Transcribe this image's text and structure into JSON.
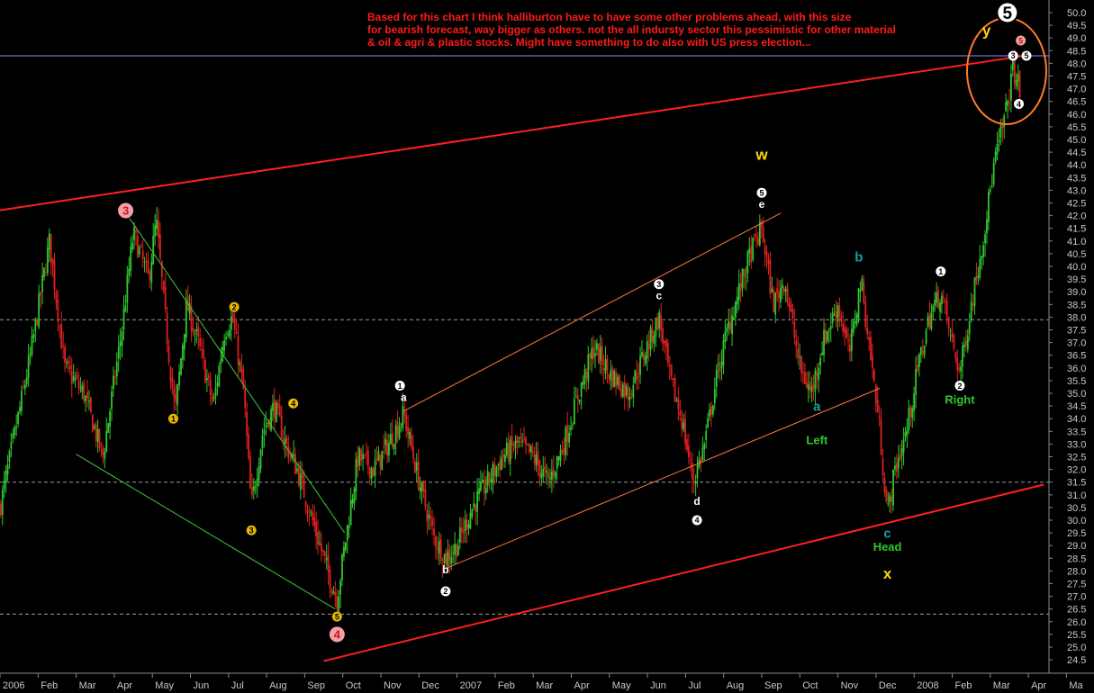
{
  "chart_data": {
    "type": "candlestick",
    "annotation_lines": [
      "Based for this chart I think halliburton have to have some other problems ahead, with this size",
      "for bearish forecast, way bigger as others. not the all indursty sector this pessimistic for other material",
      "& oil & agri & plastic stocks. Might have something to do also with US press election..."
    ],
    "x_ticks": [
      "2006",
      "Feb",
      "Mar",
      "Apr",
      "May",
      "Jun",
      "Jul",
      "Aug",
      "Sep",
      "Oct",
      "Nov",
      "Dec",
      "2007",
      "Feb",
      "Mar",
      "Apr",
      "May",
      "Jun",
      "Jul",
      "Aug",
      "Sep",
      "Oct",
      "Nov",
      "Dec",
      "2008",
      "Feb",
      "Mar",
      "Apr",
      "Ma"
    ],
    "ylim": [
      24.5,
      50.0
    ],
    "y_ticks": [
      24.5,
      25.0,
      25.5,
      26.0,
      26.5,
      27.0,
      27.5,
      28.0,
      28.5,
      29.0,
      29.5,
      30.0,
      30.5,
      31.0,
      31.5,
      32.0,
      32.5,
      33.0,
      33.5,
      34.0,
      34.5,
      35.0,
      35.5,
      36.0,
      36.5,
      37.0,
      37.5,
      38.0,
      38.5,
      39.0,
      39.5,
      40.0,
      40.5,
      41.0,
      41.5,
      42.0,
      42.5,
      43.0,
      43.5,
      44.0,
      44.5,
      45.0,
      45.5,
      46.0,
      46.5,
      47.0,
      47.5,
      48.0,
      48.5,
      49.0,
      49.5,
      50.0
    ],
    "price_pivots": [
      {
        "t": 0.0,
        "p": 30.5
      },
      {
        "t": 0.8,
        "p": 36.5
      },
      {
        "t": 1.3,
        "p": 41.0
      },
      {
        "t": 1.7,
        "p": 36.0
      },
      {
        "t": 2.2,
        "p": 35.0
      },
      {
        "t": 2.7,
        "p": 32.5
      },
      {
        "t": 3.2,
        "p": 37.5
      },
      {
        "t": 3.5,
        "p": 41.3
      },
      {
        "t": 3.9,
        "p": 39.5
      },
      {
        "t": 4.1,
        "p": 41.8
      },
      {
        "t": 4.4,
        "p": 37.0
      },
      {
        "t": 4.6,
        "p": 34.2
      },
      {
        "t": 4.9,
        "p": 38.5
      },
      {
        "t": 5.2,
        "p": 37.0
      },
      {
        "t": 5.6,
        "p": 34.5
      },
      {
        "t": 5.9,
        "p": 37.5
      },
      {
        "t": 6.1,
        "p": 38.0
      },
      {
        "t": 6.4,
        "p": 35.0
      },
      {
        "t": 6.6,
        "p": 30.5
      },
      {
        "t": 6.9,
        "p": 33.5
      },
      {
        "t": 7.2,
        "p": 34.5
      },
      {
        "t": 7.5,
        "p": 33.0
      },
      {
        "t": 7.8,
        "p": 32.0
      },
      {
        "t": 8.2,
        "p": 30.0
      },
      {
        "t": 8.6,
        "p": 28.0
      },
      {
        "t": 8.85,
        "p": 26.9
      },
      {
        "t": 9.1,
        "p": 29.5
      },
      {
        "t": 9.4,
        "p": 32.5
      },
      {
        "t": 9.8,
        "p": 32.0
      },
      {
        "t": 10.2,
        "p": 33.0
      },
      {
        "t": 10.6,
        "p": 34.2
      },
      {
        "t": 11.0,
        "p": 31.5
      },
      {
        "t": 11.4,
        "p": 29.3
      },
      {
        "t": 11.7,
        "p": 28.5
      },
      {
        "t": 12.0,
        "p": 29.0
      },
      {
        "t": 12.4,
        "p": 30.5
      },
      {
        "t": 12.8,
        "p": 31.5
      },
      {
        "t": 13.2,
        "p": 32.5
      },
      {
        "t": 13.6,
        "p": 33.0
      },
      {
        "t": 14.0,
        "p": 32.5
      },
      {
        "t": 14.4,
        "p": 31.5
      },
      {
        "t": 14.8,
        "p": 33.0
      },
      {
        "t": 15.2,
        "p": 35.0
      },
      {
        "t": 15.6,
        "p": 36.8
      },
      {
        "t": 16.0,
        "p": 35.8
      },
      {
        "t": 16.5,
        "p": 35.0
      },
      {
        "t": 16.9,
        "p": 36.5
      },
      {
        "t": 17.3,
        "p": 38.0
      },
      {
        "t": 17.6,
        "p": 35.5
      },
      {
        "t": 17.9,
        "p": 34.0
      },
      {
        "t": 18.2,
        "p": 31.5
      },
      {
        "t": 18.5,
        "p": 33.0
      },
      {
        "t": 18.8,
        "p": 35.5
      },
      {
        "t": 19.1,
        "p": 37.5
      },
      {
        "t": 19.4,
        "p": 39.0
      },
      {
        "t": 19.7,
        "p": 40.5
      },
      {
        "t": 20.0,
        "p": 41.5
      },
      {
        "t": 20.3,
        "p": 38.5
      },
      {
        "t": 20.6,
        "p": 39.5
      },
      {
        "t": 21.0,
        "p": 36.0
      },
      {
        "t": 21.3,
        "p": 35.0
      },
      {
        "t": 21.6,
        "p": 37.0
      },
      {
        "t": 22.0,
        "p": 38.5
      },
      {
        "t": 22.3,
        "p": 36.5
      },
      {
        "t": 22.6,
        "p": 39.5
      },
      {
        "t": 22.9,
        "p": 36.0
      },
      {
        "t": 23.1,
        "p": 33.5
      },
      {
        "t": 23.3,
        "p": 30.2
      },
      {
        "t": 23.5,
        "p": 32.0
      },
      {
        "t": 23.8,
        "p": 33.5
      },
      {
        "t": 24.1,
        "p": 36.0
      },
      {
        "t": 24.4,
        "p": 38.0
      },
      {
        "t": 24.7,
        "p": 39.0
      },
      {
        "t": 25.0,
        "p": 37.0
      },
      {
        "t": 25.2,
        "p": 35.8
      },
      {
        "t": 25.5,
        "p": 38.5
      },
      {
        "t": 25.8,
        "p": 41.0
      },
      {
        "t": 26.1,
        "p": 44.0
      },
      {
        "t": 26.4,
        "p": 46.0
      },
      {
        "t": 26.6,
        "p": 47.8
      },
      {
        "t": 26.8,
        "p": 46.8
      }
    ],
    "lines": [
      {
        "name": "upper-red-trendline",
        "color": "#ff2020",
        "width": 2,
        "t1": -0.5,
        "p1": 42.1,
        "t2": 26.9,
        "p2": 48.3
      },
      {
        "name": "lower-red-trendline",
        "color": "#ff2020",
        "width": 2,
        "t1": 8.5,
        "p1": 24.45,
        "t2": 27.4,
        "p2": 31.4
      },
      {
        "name": "green-upper",
        "color": "#3ec93e",
        "width": 1,
        "t1": 3.4,
        "p1": 41.9,
        "t2": 9.05,
        "p2": 29.5
      },
      {
        "name": "green-lower",
        "color": "#3ec93e",
        "width": 1,
        "t1": 2.0,
        "p1": 32.6,
        "t2": 8.8,
        "p2": 26.5
      },
      {
        "name": "orange-upper",
        "color": "#ff7a3a",
        "width": 1,
        "t1": 10.6,
        "p1": 34.3,
        "t2": 20.5,
        "p2": 42.1
      },
      {
        "name": "orange-lower",
        "color": "#ff7a3a",
        "width": 1,
        "t1": 11.7,
        "p1": 28.1,
        "t2": 23.1,
        "p2": 35.2
      }
    ],
    "hlines": [
      {
        "p": 48.3,
        "color": "#8a8aff",
        "style": "solid"
      },
      {
        "p": 37.9,
        "color": "#9a9a9a",
        "style": "dashed"
      },
      {
        "p": 31.5,
        "color": "#9a9a9a",
        "style": "dashed"
      },
      {
        "p": 26.3,
        "color": "#9a9a9a",
        "style": "dashed"
      }
    ],
    "wave_marks": [
      {
        "label": "3",
        "t": 3.3,
        "p": 42.2,
        "kind": "pink",
        "size": "big"
      },
      {
        "label": "1",
        "t": 4.55,
        "p": 34.0,
        "kind": "gold"
      },
      {
        "label": "2",
        "t": 6.15,
        "p": 38.4,
        "kind": "gold"
      },
      {
        "label": "3",
        "t": 6.6,
        "p": 29.6,
        "kind": "gold"
      },
      {
        "label": "4",
        "t": 7.7,
        "p": 34.6,
        "kind": "gold"
      },
      {
        "label": "5",
        "t": 8.85,
        "p": 26.2,
        "kind": "gold"
      },
      {
        "label": "4",
        "t": 8.85,
        "p": 25.5,
        "kind": "pink",
        "size": "big"
      },
      {
        "label": "1",
        "t": 10.5,
        "p": 35.3,
        "kind": "white"
      },
      {
        "label": "2",
        "t": 11.7,
        "p": 27.2,
        "kind": "white"
      },
      {
        "label": "3",
        "t": 17.3,
        "p": 39.3,
        "kind": "white"
      },
      {
        "label": "4",
        "t": 18.3,
        "p": 30.0,
        "kind": "white"
      },
      {
        "label": "5",
        "t": 20.0,
        "p": 42.9,
        "kind": "white"
      },
      {
        "label": "1",
        "t": 24.7,
        "p": 39.8,
        "kind": "white"
      },
      {
        "label": "2",
        "t": 25.2,
        "p": 35.3,
        "kind": "white"
      },
      {
        "label": "3",
        "t": 26.6,
        "p": 48.3,
        "kind": "white"
      },
      {
        "label": "5",
        "t": 26.95,
        "p": 48.3,
        "kind": "white"
      },
      {
        "label": "4",
        "t": 26.75,
        "p": 46.4,
        "kind": "white"
      },
      {
        "label": "5",
        "t": 26.8,
        "p": 48.9,
        "kind": "pink"
      },
      {
        "label": "5",
        "t": 26.45,
        "p": 50.0,
        "kind": "white",
        "size": "huge"
      }
    ],
    "text_marks": [
      {
        "text": "a",
        "t": 10.6,
        "p": 34.7,
        "color": "#ffffff",
        "size": 12
      },
      {
        "text": "b",
        "t": 11.7,
        "p": 27.9,
        "color": "#ffffff",
        "size": 12
      },
      {
        "text": "c",
        "t": 17.3,
        "p": 38.7,
        "color": "#ffffff",
        "size": 12
      },
      {
        "text": "d",
        "t": 18.3,
        "p": 30.6,
        "color": "#ffffff",
        "size": 12
      },
      {
        "text": "e",
        "t": 20.0,
        "p": 42.3,
        "color": "#ffffff",
        "size": 12
      },
      {
        "text": "w",
        "t": 20.0,
        "p": 44.2,
        "color": "#ffd700",
        "size": 17
      },
      {
        "text": "b",
        "t": 22.55,
        "p": 40.2,
        "color": "#1e9aa0",
        "size": 15
      },
      {
        "text": "a",
        "t": 21.45,
        "p": 34.3,
        "color": "#1e9aa0",
        "size": 15
      },
      {
        "text": "Left",
        "t": 21.45,
        "p": 33.0,
        "color": "#2ec82e",
        "size": 13
      },
      {
        "text": "c",
        "t": 23.3,
        "p": 29.3,
        "color": "#1e9aa0",
        "size": 15
      },
      {
        "text": "Head",
        "t": 23.3,
        "p": 28.8,
        "color": "#2ec82e",
        "size": 13
      },
      {
        "text": "x",
        "t": 23.3,
        "p": 27.7,
        "color": "#ffd700",
        "size": 17
      },
      {
        "text": "Right",
        "t": 25.2,
        "p": 34.6,
        "color": "#2ec82e",
        "size": 13
      },
      {
        "text": "y",
        "t": 25.9,
        "p": 49.1,
        "color": "#ffd700",
        "size": 17
      }
    ]
  }
}
